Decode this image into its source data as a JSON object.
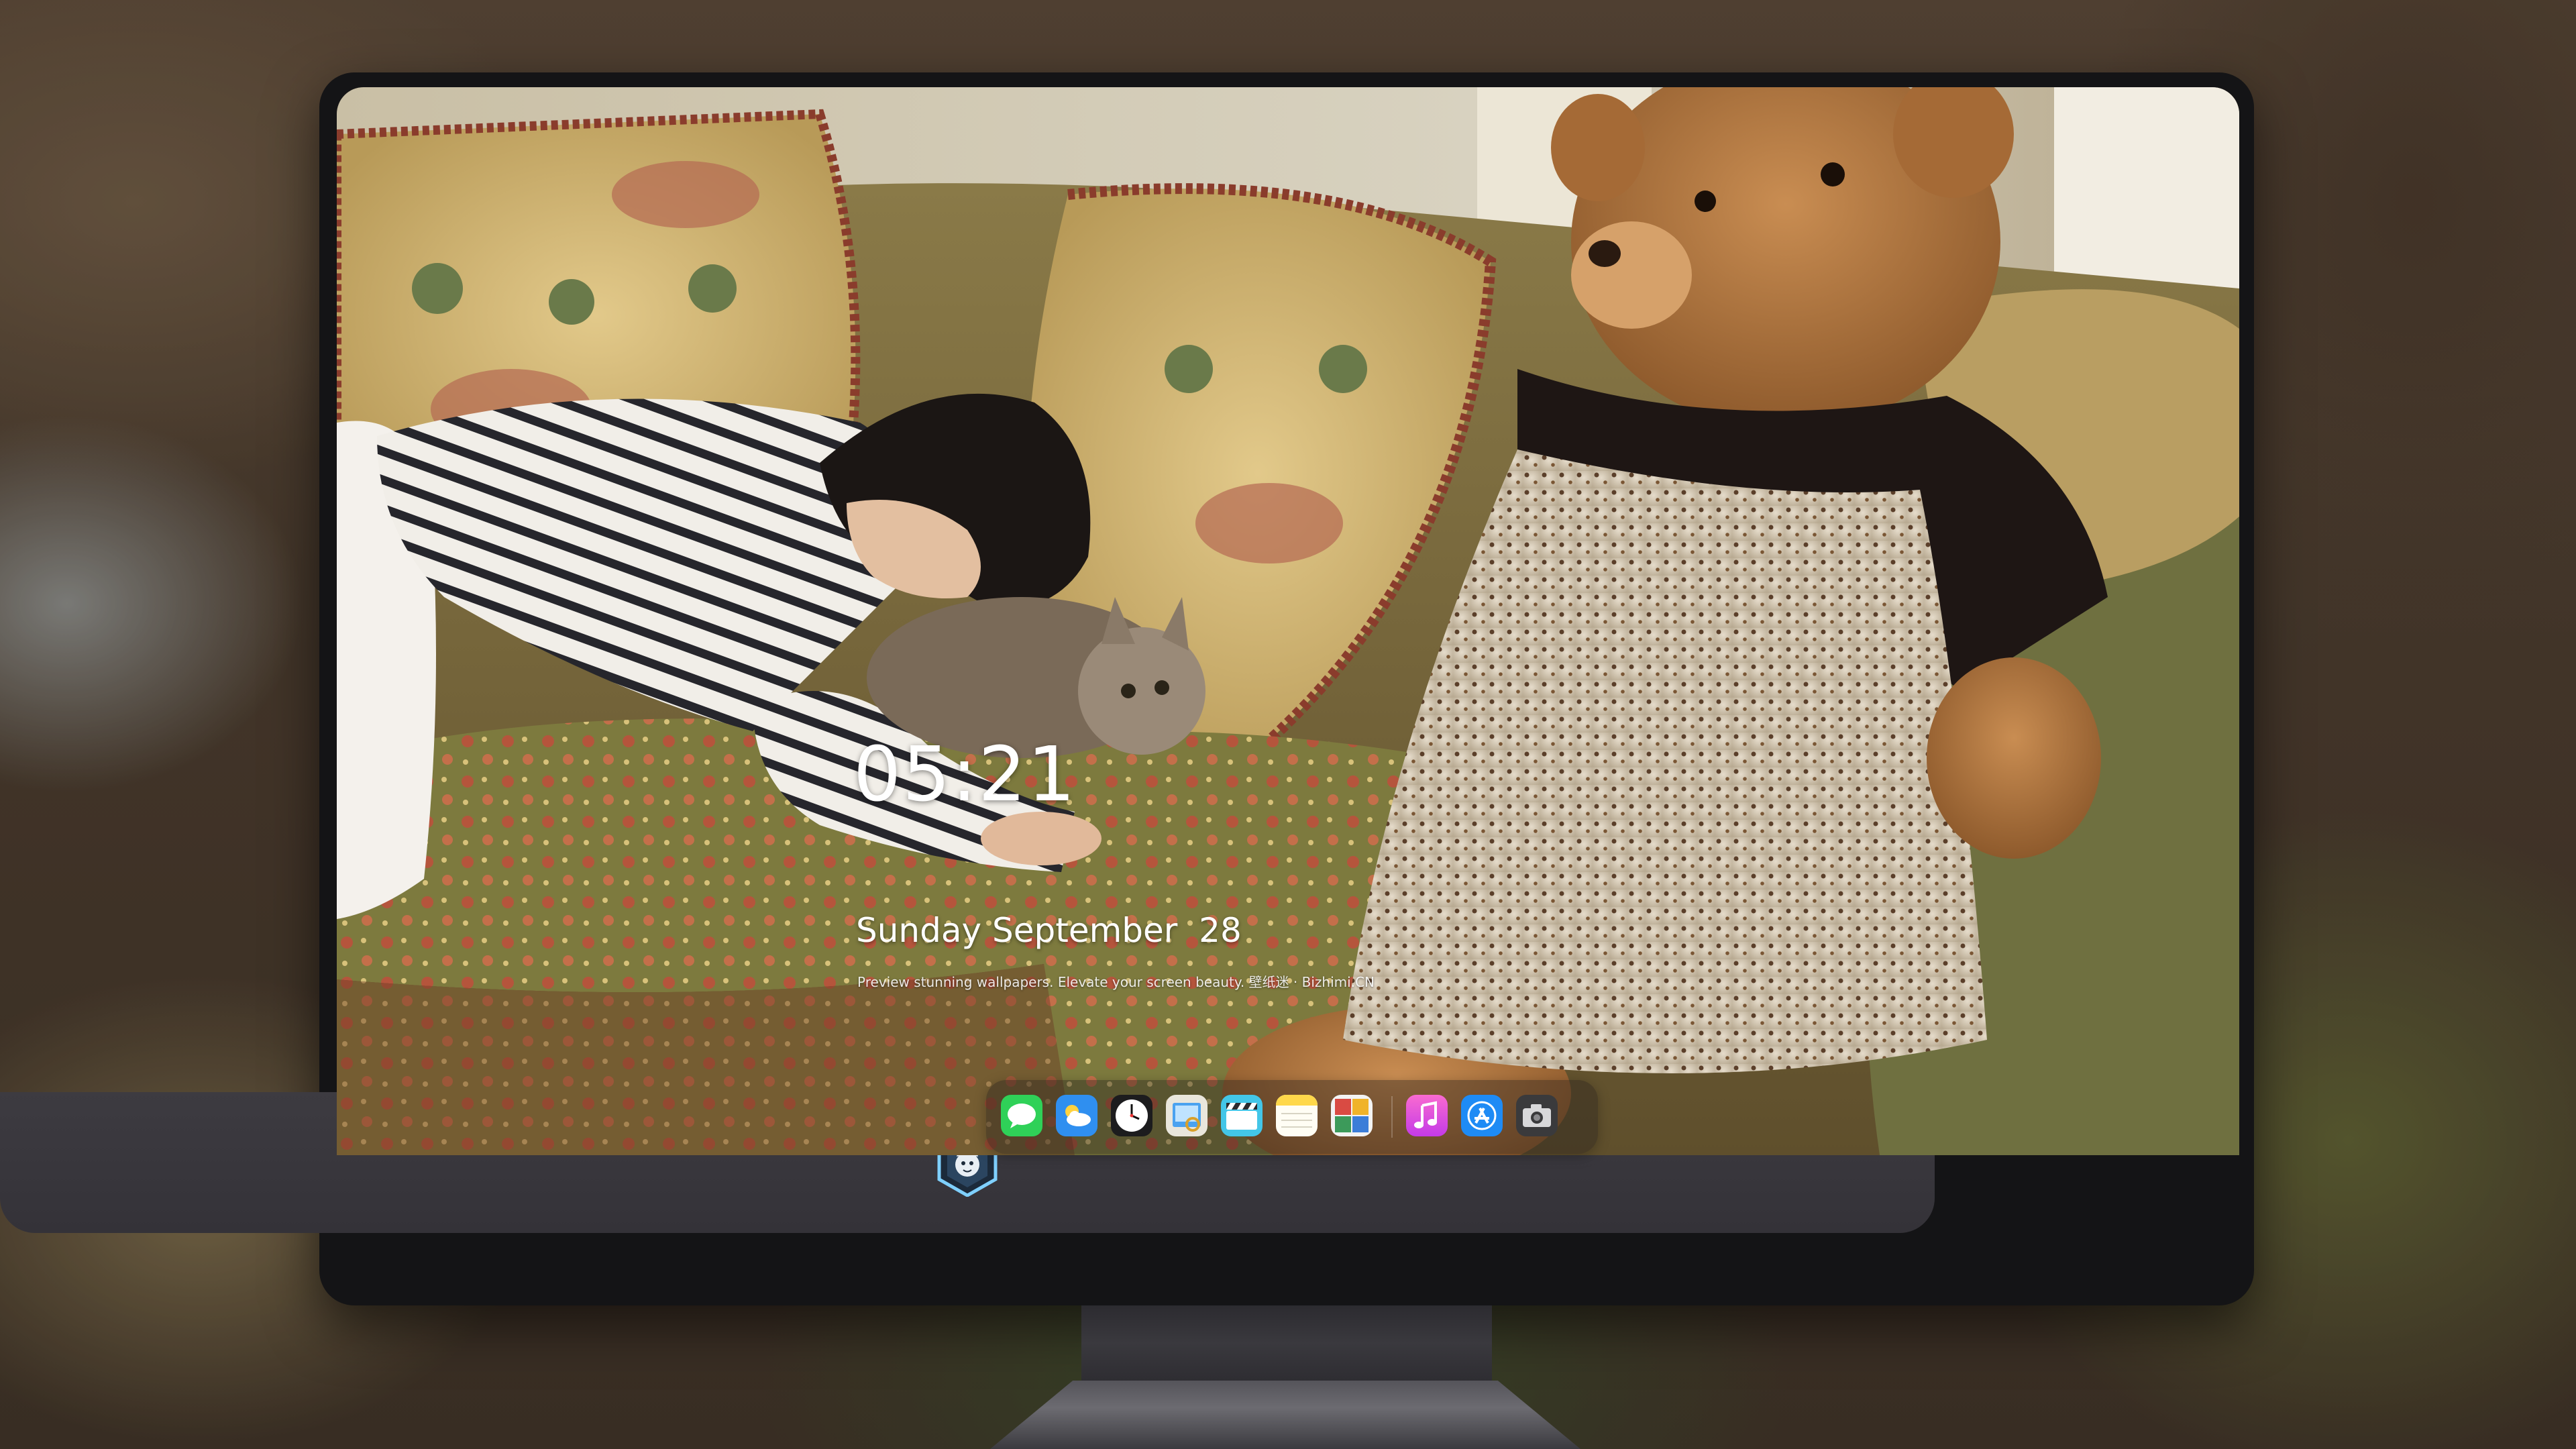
{
  "lockscreen": {
    "time": "05:21",
    "date": "Sunday September  28",
    "tagline": "Preview stunning wallpapers. Elevate your screen beauty. 壁纸迷 · Bizhimi.CN"
  },
  "wallpaper": {
    "scene": "woman-sleeping-with-cat-on-floral-sofa-beside-teddy-bear"
  },
  "dock": {
    "apps": [
      {
        "name": "Messages",
        "icon": "messages-icon",
        "color": "#2fd158"
      },
      {
        "name": "Weather",
        "icon": "weather-icon",
        "color": "#2f8ff0"
      },
      {
        "name": "Clock",
        "icon": "clock-icon",
        "color": "#1c1c1e"
      },
      {
        "name": "Preview",
        "icon": "preview-icon",
        "color": "#e9e6dc"
      },
      {
        "name": "Clips",
        "icon": "clips-icon",
        "color": "#43c6e8"
      },
      {
        "name": "Notes",
        "icon": "notes-icon",
        "color": "#ffd84a"
      },
      {
        "name": "Photo Booth",
        "icon": "photo-booth-icon",
        "color": "#d94b43"
      },
      {
        "name": "Music",
        "icon": "music-icon",
        "color": "#f04fd8"
      },
      {
        "name": "App Store",
        "icon": "app-store-icon",
        "color": "#1e8bf5"
      },
      {
        "name": "Screenshot",
        "icon": "camera-icon",
        "color": "#3a3a3c"
      }
    ]
  },
  "monitor": {
    "chin_logo": "bizhimi-logo"
  },
  "colors": {
    "bezel": "#141416",
    "chin": "#3a383e",
    "text": "#ffffff"
  }
}
